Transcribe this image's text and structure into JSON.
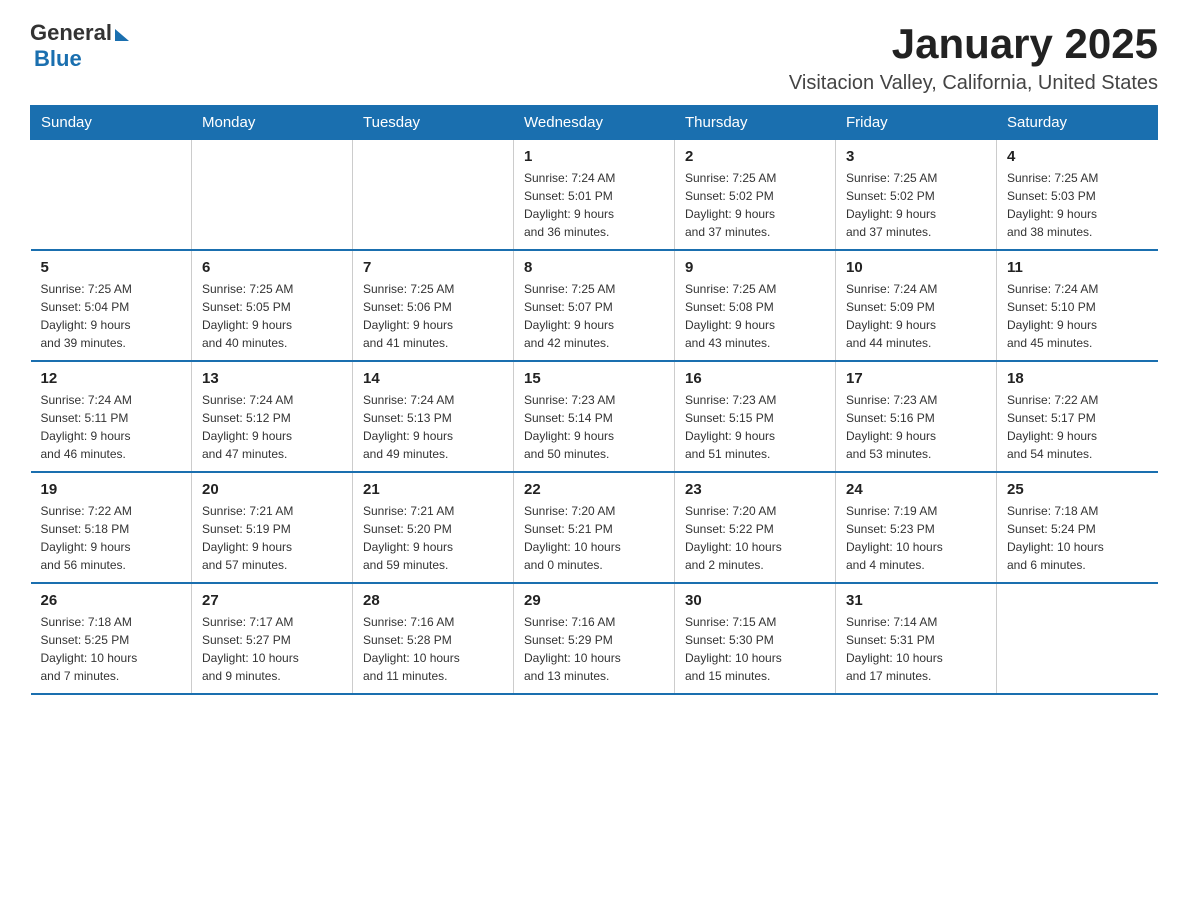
{
  "header": {
    "logo": {
      "general": "General",
      "blue": "Blue"
    },
    "month": "January 2025",
    "location": "Visitacion Valley, California, United States"
  },
  "weekdays": [
    "Sunday",
    "Monday",
    "Tuesday",
    "Wednesday",
    "Thursday",
    "Friday",
    "Saturday"
  ],
  "weeks": [
    [
      {
        "day": "",
        "info": ""
      },
      {
        "day": "",
        "info": ""
      },
      {
        "day": "",
        "info": ""
      },
      {
        "day": "1",
        "info": "Sunrise: 7:24 AM\nSunset: 5:01 PM\nDaylight: 9 hours\nand 36 minutes."
      },
      {
        "day": "2",
        "info": "Sunrise: 7:25 AM\nSunset: 5:02 PM\nDaylight: 9 hours\nand 37 minutes."
      },
      {
        "day": "3",
        "info": "Sunrise: 7:25 AM\nSunset: 5:02 PM\nDaylight: 9 hours\nand 37 minutes."
      },
      {
        "day": "4",
        "info": "Sunrise: 7:25 AM\nSunset: 5:03 PM\nDaylight: 9 hours\nand 38 minutes."
      }
    ],
    [
      {
        "day": "5",
        "info": "Sunrise: 7:25 AM\nSunset: 5:04 PM\nDaylight: 9 hours\nand 39 minutes."
      },
      {
        "day": "6",
        "info": "Sunrise: 7:25 AM\nSunset: 5:05 PM\nDaylight: 9 hours\nand 40 minutes."
      },
      {
        "day": "7",
        "info": "Sunrise: 7:25 AM\nSunset: 5:06 PM\nDaylight: 9 hours\nand 41 minutes."
      },
      {
        "day": "8",
        "info": "Sunrise: 7:25 AM\nSunset: 5:07 PM\nDaylight: 9 hours\nand 42 minutes."
      },
      {
        "day": "9",
        "info": "Sunrise: 7:25 AM\nSunset: 5:08 PM\nDaylight: 9 hours\nand 43 minutes."
      },
      {
        "day": "10",
        "info": "Sunrise: 7:24 AM\nSunset: 5:09 PM\nDaylight: 9 hours\nand 44 minutes."
      },
      {
        "day": "11",
        "info": "Sunrise: 7:24 AM\nSunset: 5:10 PM\nDaylight: 9 hours\nand 45 minutes."
      }
    ],
    [
      {
        "day": "12",
        "info": "Sunrise: 7:24 AM\nSunset: 5:11 PM\nDaylight: 9 hours\nand 46 minutes."
      },
      {
        "day": "13",
        "info": "Sunrise: 7:24 AM\nSunset: 5:12 PM\nDaylight: 9 hours\nand 47 minutes."
      },
      {
        "day": "14",
        "info": "Sunrise: 7:24 AM\nSunset: 5:13 PM\nDaylight: 9 hours\nand 49 minutes."
      },
      {
        "day": "15",
        "info": "Sunrise: 7:23 AM\nSunset: 5:14 PM\nDaylight: 9 hours\nand 50 minutes."
      },
      {
        "day": "16",
        "info": "Sunrise: 7:23 AM\nSunset: 5:15 PM\nDaylight: 9 hours\nand 51 minutes."
      },
      {
        "day": "17",
        "info": "Sunrise: 7:23 AM\nSunset: 5:16 PM\nDaylight: 9 hours\nand 53 minutes."
      },
      {
        "day": "18",
        "info": "Sunrise: 7:22 AM\nSunset: 5:17 PM\nDaylight: 9 hours\nand 54 minutes."
      }
    ],
    [
      {
        "day": "19",
        "info": "Sunrise: 7:22 AM\nSunset: 5:18 PM\nDaylight: 9 hours\nand 56 minutes."
      },
      {
        "day": "20",
        "info": "Sunrise: 7:21 AM\nSunset: 5:19 PM\nDaylight: 9 hours\nand 57 minutes."
      },
      {
        "day": "21",
        "info": "Sunrise: 7:21 AM\nSunset: 5:20 PM\nDaylight: 9 hours\nand 59 minutes."
      },
      {
        "day": "22",
        "info": "Sunrise: 7:20 AM\nSunset: 5:21 PM\nDaylight: 10 hours\nand 0 minutes."
      },
      {
        "day": "23",
        "info": "Sunrise: 7:20 AM\nSunset: 5:22 PM\nDaylight: 10 hours\nand 2 minutes."
      },
      {
        "day": "24",
        "info": "Sunrise: 7:19 AM\nSunset: 5:23 PM\nDaylight: 10 hours\nand 4 minutes."
      },
      {
        "day": "25",
        "info": "Sunrise: 7:18 AM\nSunset: 5:24 PM\nDaylight: 10 hours\nand 6 minutes."
      }
    ],
    [
      {
        "day": "26",
        "info": "Sunrise: 7:18 AM\nSunset: 5:25 PM\nDaylight: 10 hours\nand 7 minutes."
      },
      {
        "day": "27",
        "info": "Sunrise: 7:17 AM\nSunset: 5:27 PM\nDaylight: 10 hours\nand 9 minutes."
      },
      {
        "day": "28",
        "info": "Sunrise: 7:16 AM\nSunset: 5:28 PM\nDaylight: 10 hours\nand 11 minutes."
      },
      {
        "day": "29",
        "info": "Sunrise: 7:16 AM\nSunset: 5:29 PM\nDaylight: 10 hours\nand 13 minutes."
      },
      {
        "day": "30",
        "info": "Sunrise: 7:15 AM\nSunset: 5:30 PM\nDaylight: 10 hours\nand 15 minutes."
      },
      {
        "day": "31",
        "info": "Sunrise: 7:14 AM\nSunset: 5:31 PM\nDaylight: 10 hours\nand 17 minutes."
      },
      {
        "day": "",
        "info": ""
      }
    ]
  ]
}
